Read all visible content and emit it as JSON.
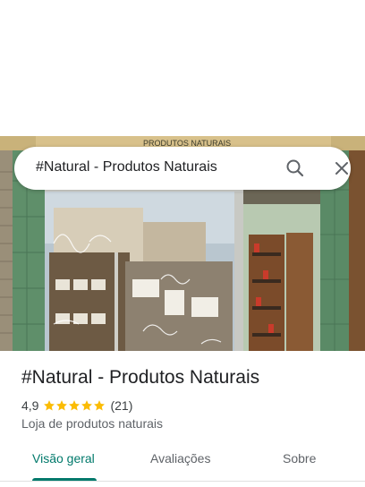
{
  "search": {
    "query": "#Natural - Produtos Naturais",
    "search_icon": "search-icon",
    "close_icon": "close-icon"
  },
  "photo": {
    "sign_text": "PRODUTOS NATURAIS"
  },
  "place": {
    "name": "#Natural - Produtos Naturais",
    "rating": "4,9",
    "stars": 5,
    "reviews": "(21)",
    "category": "Loja de produtos naturais"
  },
  "tabs": [
    {
      "label": "Visão geral",
      "active": true
    },
    {
      "label": "Avaliações",
      "active": false
    },
    {
      "label": "Sobre",
      "active": false
    }
  ],
  "colors": {
    "accent": "#00796b",
    "star": "#fbbc04",
    "text": "#202124",
    "secondary": "#5f6368"
  }
}
